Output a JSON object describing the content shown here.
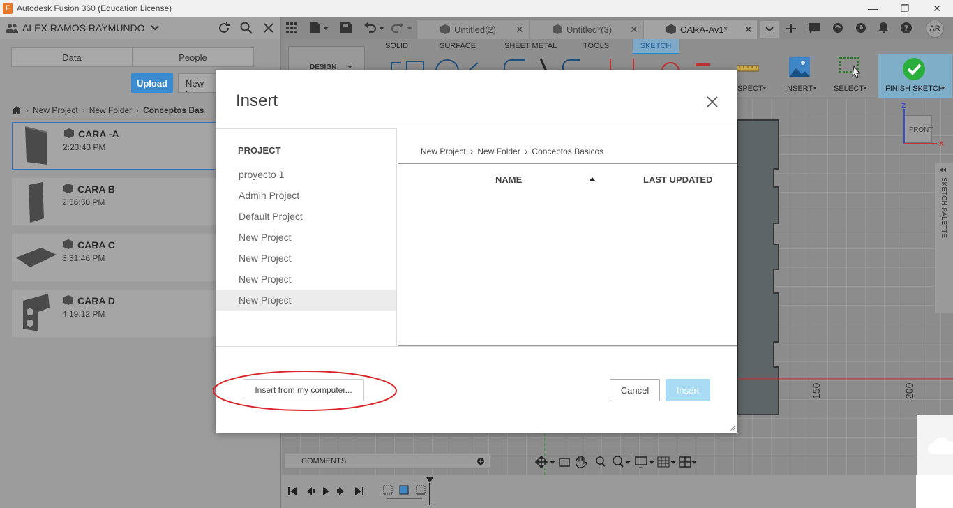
{
  "titlebar": {
    "title": "Autodesk Fusion 360 (Education License)"
  },
  "user": {
    "name": "ALEX RAMOS RAYMUNDO",
    "initials": "AR"
  },
  "data_panel": {
    "tabs": [
      "Data",
      "People"
    ],
    "upload_label": "Upload",
    "new_folder_label": "New Fo",
    "breadcrumb": [
      "New Project",
      "New Folder",
      "Conceptos Bas"
    ],
    "files": [
      {
        "name": "CARA -A",
        "time": "2:23:43 PM"
      },
      {
        "name": "CARA B",
        "time": "2:56:50 PM"
      },
      {
        "name": "CARA C",
        "time": "3:31:46 PM"
      },
      {
        "name": "CARA D",
        "time": "4:19:12 PM"
      }
    ]
  },
  "doc_tabs": [
    "Untitled(2)",
    "Untitled*(3)",
    "CARA-Av1*"
  ],
  "toolbar": {
    "workspace": "DESIGN",
    "tabs": [
      "SOLID",
      "SURFACE",
      "SHEET METAL",
      "TOOLS",
      "SKETCH"
    ],
    "active_tab": "SKETCH",
    "groups": [
      "SPECT",
      "INSERT",
      "SELECT",
      "FINISH SKETCH"
    ]
  },
  "viewcube": {
    "face": "FRONT",
    "z": "Z",
    "x": "X"
  },
  "sketch_palette": "SKETCH PALETTE",
  "axis_labels": [
    "150",
    "200"
  ],
  "comments_label": "COMMENTS",
  "modal": {
    "title": "Insert",
    "project_heading": "PROJECT",
    "projects": [
      "proyecto 1",
      "Admin Project",
      "Default Project",
      "New Project",
      "New Project",
      "New Project",
      "New Project"
    ],
    "breadcrumb": [
      "New Project",
      "New Folder",
      "Conceptos Basicos"
    ],
    "col_name": "NAME",
    "col_updated": "LAST UPDATED",
    "insert_from_computer": "Insert from my computer...",
    "cancel": "Cancel",
    "insert": "Insert"
  },
  "colors": {
    "sketch_tab": "#1a8fd9",
    "finish_green": "#2aaf3c",
    "insert_btn": "#a8dcf5",
    "upload_btn": "#3a8ad0",
    "highlight_circle": "#d9262b"
  }
}
